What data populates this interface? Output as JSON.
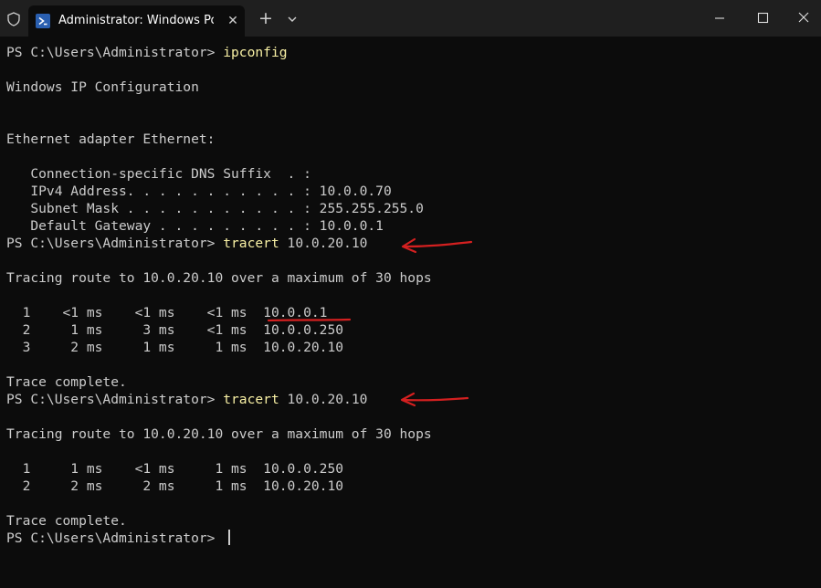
{
  "titlebar": {
    "tab_title": "Administrator: Windows PowerShell",
    "tab_close": "✕",
    "new_tab": "+"
  },
  "terminal": {
    "lines": {
      "l1": {
        "prompt": "PS C:\\Users\\Administrator> ",
        "command": "ipconfig"
      },
      "l2": "Windows IP Configuration",
      "l3": "Ethernet adapter Ethernet:",
      "l4": "   Connection-specific DNS Suffix  . :",
      "l5": "   IPv4 Address. . . . . . . . . . . : 10.0.0.70",
      "l6": "   Subnet Mask . . . . . . . . . . . : 255.255.255.0",
      "l7": "   Default Gateway . . . . . . . . . : 10.0.0.1",
      "l8": {
        "prompt": "PS C:\\Users\\Administrator> ",
        "command": "tracert",
        "args": " 10.0.20.10"
      },
      "l9": "Tracing route to 10.0.20.10 over a maximum of 30 hops",
      "l10": "  1    <1 ms    <1 ms    <1 ms  10.0.0.1",
      "l11": "  2     1 ms     3 ms    <1 ms  10.0.0.250",
      "l12": "  3     2 ms     1 ms     1 ms  10.0.20.10",
      "l13": "Trace complete.",
      "l14": {
        "prompt": "PS C:\\Users\\Administrator> ",
        "command": "tracert",
        "args": " 10.0.20.10"
      },
      "l15": "Tracing route to 10.0.20.10 over a maximum of 30 hops",
      "l16": "  1     1 ms    <1 ms     1 ms  10.0.0.250",
      "l17": "  2     2 ms     2 ms     1 ms  10.0.20.10",
      "l18": "Trace complete.",
      "l19": {
        "prompt": "PS C:\\Users\\Administrator> "
      }
    }
  },
  "colors": {
    "background": "#0c0c0c",
    "titlebar": "#1f1f1f",
    "text": "#cccccc",
    "command": "#f9f1a5",
    "annotation": "#d42020"
  }
}
